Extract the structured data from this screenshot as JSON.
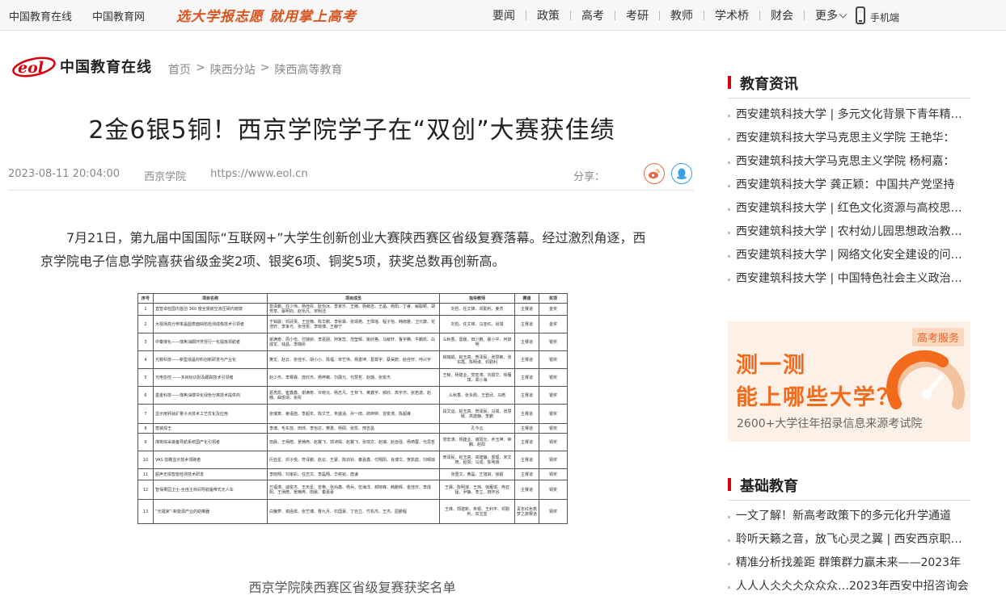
{
  "topbar": {
    "site_links": [
      "中国教育在线",
      "中国教育网"
    ],
    "slogan": "选大学报志愿 就用掌上高考",
    "nav": [
      "要闻",
      "政策",
      "高考",
      "考研",
      "教师",
      "学术桥",
      "财会"
    ],
    "more": "更多",
    "mobile": "手机端"
  },
  "logo": {
    "text": "中国教育在线",
    "mark_text": "eol"
  },
  "breadcrumb": [
    "首页",
    "陕西分站",
    "陕西高等教育"
  ],
  "article": {
    "title": "2金6银5铜！西京学院学子在“双创”大赛获佳绩",
    "date": "2023-08-11 20:04:00",
    "source": "西京学院",
    "url": "https://www.eol.cn",
    "share_label": "分享：",
    "paragraph": "7月21日，第九届中国国际“互联网+”大学生创新创业大赛陕西赛区省级复赛落幕。经过激烈角逐，西京学院电子信息学院喜获省级金奖2项、银奖6项、铜奖5项，获奖总数再创新高。",
    "image_caption": "西京学院陕西赛区省级复赛获奖名单"
  },
  "award_table": {
    "headers": [
      "序号",
      "项目名称",
      "项目成员",
      "指导教师",
      "赛道",
      "奖项"
    ],
    "rows": [
      [
        "1",
        "直智卓检国内首创 360 度全景航空液压阀内窥镜",
        "雷泽鹏、任少伟、杨佳彤、耿怡冰、李家乐、王楠、杨萌吉、王晶、杨阳、丁睿、解聪颖、胡芳草、蔡明钧、赵怡凡、宋明洁",
        "刘哲、任文锋、邓勤利、姜杰",
        "主赛道",
        "金奖"
      ],
      [
        "2",
        "大视场高分辨率晶圆表面缺陷检测成像技术引领者",
        "于铂骏、邓武贡、王亚楠、陈华鹏、李秋霖、张靖苑、王怿瑶、程子怡、韩雨雅、卫元康、花浩轩、李争光、张佳俊、李晓博、王静宁",
        "刘哲、任文锋、马亚红、肖琪",
        "主赛道",
        "金奖"
      ],
      [
        "3",
        "中秦煤化——煤焦油酮环芳烃行一化提炼领航者",
        "谢满奇、周小伍、付婧娇、李嘉朋、阿家蕊、范莹辉、姚欣格、马敏轩、鲁宇腾、牛麟凯、白成龙、钱昌、李璐彤",
        "么秋香、葛媛、田少鹏、翟小平、何焯明",
        "主赛道",
        "银奖"
      ],
      [
        "4",
        "光致科技——新型液晶材料创新研发与产业化",
        "樊龙、赵云、张佳乐、胡小小、陈福、宋艺伟、杨富坤、葛霄宇、蔡昊蔚、赵佳轩、呼兴宇",
        "姚瑞娟、赵玉真、贺泽民、张慧敏、张东霞、陈明淑、邓勤利",
        "主赛道",
        "银奖"
      ],
      [
        "5",
        "光电协控 ——多目标识别及跟踪技术引领者",
        "赵少杰、李骞霖、庞欣杰、杨梓薇、刘展元、代慧哲、赵璐、张俊杰",
        "王晰、杨建业、党宏涛、刘振华、徐雁琪、郑小海",
        "主赛道",
        "银奖"
      ],
      [
        "6",
        "墨金科技——煤焦油楼块化绿色分离技术提供商",
        "葛亮凯、崔鑫鑫、谢满奇、许晓沅、杨志凡、王林飞、黄鑫宇、郝欣、高宇杰、张若波、赵楠、曲悦靖、余彤",
        "么秋香、张永刚、王登武、马皓",
        "主赛道",
        "银奖"
      ],
      [
        "7",
        "显示用钙钛矿量子点技术工艺优化及应用",
        "张瑞寅、姜语菡、李超年、陈文艺、朱盛涵、孙一田、郎婷婷、曾俊涛、陈超峰",
        "段文运、赵玉真、贺泽民、马成、张慧敏、高建静、李鹏",
        "主赛道",
        "银奖"
      ],
      [
        "8",
        "蓖装焊王",
        "李博、毛东放、田帅、李怡达、樊勇、杨硕、张凯、邢吉昌",
        "孔今云",
        "主赛道",
        "银奖"
      ],
      [
        "9",
        "煤炭综采装备导航系统国产化引领者",
        "田晨、王柄皓、景楠冉、赵翼飞、郭诗娟、赵翼飞、张琼文、赵瑞、赵自强、杨琦蓉、代思哲",
        "党宏涛、杨建业、谢阳光、乔玉坤、钟麟、赵阳",
        "主赛道",
        "铜奖"
      ],
      [
        "10",
        "VAS 前瞻显示技术领跑者",
        "历亚星、邓子悦、符译鹏、赵云、王蒙、陈劲铃、秦嘉鑫、付翔阳、肖博文、贺凯庭、刘晴琼",
        "贺泽民、赵玉真、高建静、郭理、宋文琦、赵阳、马成、陈明淑",
        "主赛道",
        "铜奖"
      ],
      [
        "11",
        "超声无损智能检测技术研发",
        "李晓翔、刘家彩、任志文、李磊翔、华奕铭、唐谦",
        "张晋文、黄磊、王旭启、徐超",
        "主赛道",
        "铜奖"
      ],
      [
        "12",
        "智保果园卫士-全自主林间导航履带式无人车",
        "万福涛、戚俊杰、王天星、曾艳、张尚鑫、杨兵、伍海洋、郝晓峰、韩鹏辉、金佳庆、李成阳、王炳皓、景楠冉、田晨、秦嘉豪",
        "王霖、陈明淑、王玮、徐雁琪、冉亚猛、尹静、李立、田怀谷",
        "主赛道",
        "铜奖"
      ],
      [
        "13",
        "“光福家”-新能源产业的助推器",
        "白騰萝、谢函翠、张艺博、曹九月、石国豪、丁自立、竹机杰、王杰、屈鹏程",
        "王烽、郭建新、朱银、王利平、邓勤利、袁宝玺",
        "青年红色筑梦之旅赛道",
        "铜奖"
      ]
    ]
  },
  "sidebar": {
    "news_title": "教育资讯",
    "news": [
      "西安建筑科技大学 | 多元文化背景下青年精神文化建设",
      "西安建筑科技大学马克思主义学院 王艳华：",
      "西安建筑科技大学马克思主义学院 杨柯嘉：",
      "西安建筑科技大学 龚正颖：中国共产党坚持",
      "西安建筑科技大学 | 红色文化资源与高校思想政治教育",
      "西安建筑科技大学 | 农村幼儿园思想政治教育研究",
      "西安建筑科技大学 | 网络文化安全建设的问题与对策",
      "西安建筑科技大学 | 中国特色社会主义政治经济学"
    ],
    "ad": {
      "badge": "高考服务",
      "line1": "测一测",
      "line2": "能上哪些大学？",
      "line3": "2600+大学往年招录信息来源考试院"
    },
    "basic_title": "基础教育",
    "basic": [
      "一文了解！新高考政策下的多元化升学通道",
      "聆听天籁之音，放飞心灵之翼 | 西安西京职业学院",
      "精准分析找差距 群策群力赢未来——2023年",
      "人人人仌仌仌众众众…2023年西安中招咨询会"
    ]
  },
  "colors": {
    "accent": "#d7000f",
    "ad_orange": "#f26b1d",
    "slogan": "#d9541f"
  }
}
